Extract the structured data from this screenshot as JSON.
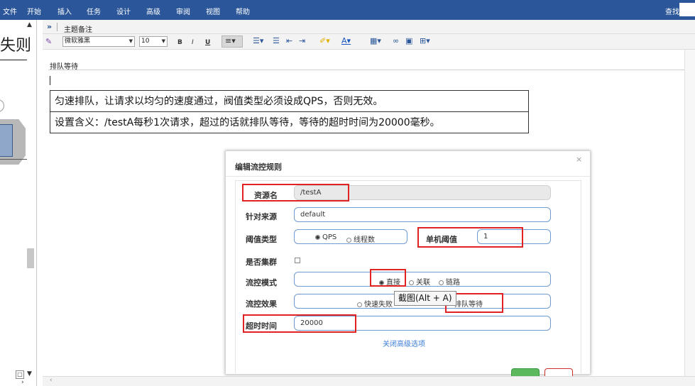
{
  "menu": {
    "items": [
      "文件",
      "开始",
      "插入",
      "任务",
      "设计",
      "高级",
      "审阅",
      "视图",
      "帮助"
    ],
    "search_label": "查找:"
  },
  "outline": {
    "partial_text": "失则"
  },
  "notes": {
    "toggle": "»",
    "title": "主题备注",
    "font": "微软雅黑",
    "size": "10",
    "bold": "B",
    "italic": "I",
    "underline": "U",
    "heading": "排队等待",
    "table": [
      "匀速排队，让请求以均匀的速度通过，阀值类型必须设成QPS，否则无效。",
      "设置含义：/testA每秒1次请求，超过的话就排队等待，等待的超时时间为20000毫秒。"
    ]
  },
  "dialog": {
    "title": "编辑流控规则",
    "close": "×",
    "resource_label": "资源名",
    "resource_value": "/testA",
    "origin_label": "针对来源",
    "origin_value": "default",
    "threshold_type_label": "阈值类型",
    "threshold_qps": "QPS",
    "threshold_threads": "线程数",
    "single_threshold_label": "单机阈值",
    "single_threshold_value": "1",
    "cluster_label": "是否集群",
    "mode_label": "流控模式",
    "mode_direct": "直接",
    "mode_relate": "关联",
    "mode_chain": "链路",
    "effect_label": "流控效果",
    "effect_fast_fail": "快速失败",
    "effect_queue": "排队等待",
    "timeout_label": "超时时间",
    "timeout_value": "20000",
    "advanced_link": "关闭高级选项",
    "tooltip": "截图(Alt + A)"
  },
  "colors": {
    "menubar": "#2b579a",
    "highlight_red": "#e02222",
    "field_border": "#6f9bd1",
    "link": "#3b7dd8"
  },
  "icons": {
    "format_painter": "format-painter-icon",
    "align_left": "align-left-icon",
    "bullet_list": "bullet-list-icon",
    "numbered_list": "numbered-list-icon",
    "indent_decrease": "indent-decrease-icon",
    "indent_increase": "indent-increase-icon",
    "highlight": "highlight-color-icon",
    "font_color": "font-color-icon",
    "table": "table-icon",
    "link": "hyperlink-icon",
    "image": "image-icon",
    "attachment": "attachment-icon"
  }
}
